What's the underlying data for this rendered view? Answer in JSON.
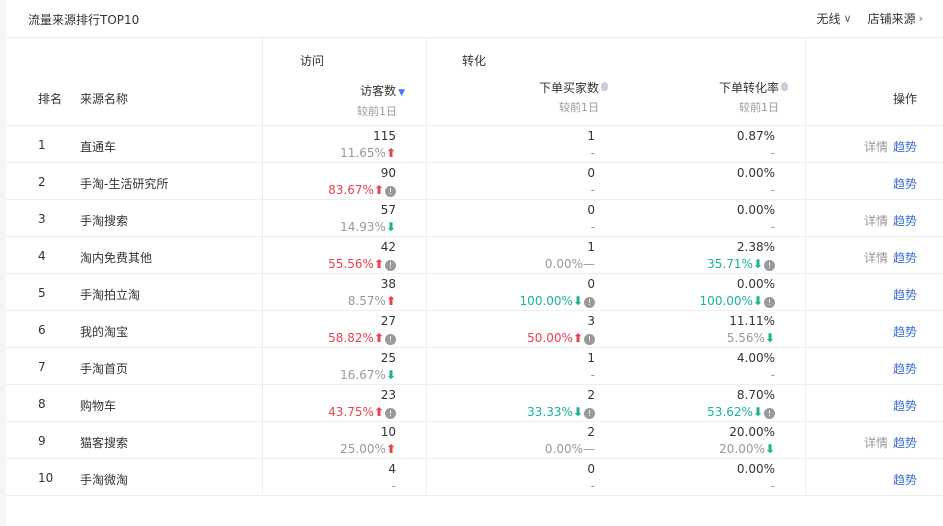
{
  "header": {
    "title": "流量来源排行TOP10",
    "device_label": "无线",
    "source_label": "店铺来源"
  },
  "groups": {
    "visit": "访问",
    "convert": "转化"
  },
  "columns": {
    "rank": "排名",
    "name": "来源名称",
    "visitors": "访客数",
    "buyers": "下单买家数",
    "rate": "下单转化率",
    "compare": "较前1日",
    "action": "操作"
  },
  "actions": {
    "detail": "详情",
    "trend": "趋势"
  },
  "rows": [
    {
      "rank": "1",
      "name": "直通车",
      "visitors": "115",
      "visitors_cmp": "11.65%",
      "visitors_dir": "up",
      "visitors_color": "gray",
      "visitors_q": false,
      "buyers": "1",
      "buyers_cmp": "-",
      "buyers_dir": "",
      "buyers_color": "gray",
      "buyers_q": false,
      "rate": "0.87%",
      "rate_cmp": "-",
      "rate_dir": "",
      "rate_color": "gray",
      "rate_q": false,
      "detail": true
    },
    {
      "rank": "2",
      "name": "手淘-生活研究所",
      "visitors": "90",
      "visitors_cmp": "83.67%",
      "visitors_dir": "up",
      "visitors_color": "red",
      "visitors_q": true,
      "buyers": "0",
      "buyers_cmp": "-",
      "buyers_dir": "",
      "buyers_color": "gray",
      "buyers_q": false,
      "rate": "0.00%",
      "rate_cmp": "-",
      "rate_dir": "",
      "rate_color": "gray",
      "rate_q": false,
      "detail": false
    },
    {
      "rank": "3",
      "name": "手淘搜索",
      "visitors": "57",
      "visitors_cmp": "14.93%",
      "visitors_dir": "down",
      "visitors_color": "gray",
      "visitors_q": false,
      "buyers": "0",
      "buyers_cmp": "-",
      "buyers_dir": "",
      "buyers_color": "gray",
      "buyers_q": false,
      "rate": "0.00%",
      "rate_cmp": "-",
      "rate_dir": "",
      "rate_color": "gray",
      "rate_q": false,
      "detail": true
    },
    {
      "rank": "4",
      "name": "淘内免费其他",
      "visitors": "42",
      "visitors_cmp": "55.56%",
      "visitors_dir": "up",
      "visitors_color": "red",
      "visitors_q": true,
      "buyers": "1",
      "buyers_cmp": "0.00%",
      "buyers_dir": "flat",
      "buyers_color": "gray",
      "buyers_q": false,
      "rate": "2.38%",
      "rate_cmp": "35.71%",
      "rate_dir": "down",
      "rate_color": "green",
      "rate_q": true,
      "detail": true
    },
    {
      "rank": "5",
      "name": "手淘拍立淘",
      "visitors": "38",
      "visitors_cmp": "8.57%",
      "visitors_dir": "up",
      "visitors_color": "gray",
      "visitors_q": false,
      "buyers": "0",
      "buyers_cmp": "100.00%",
      "buyers_dir": "down",
      "buyers_color": "green",
      "buyers_q": true,
      "rate": "0.00%",
      "rate_cmp": "100.00%",
      "rate_dir": "down",
      "rate_color": "green",
      "rate_q": true,
      "detail": false
    },
    {
      "rank": "6",
      "name": "我的淘宝",
      "visitors": "27",
      "visitors_cmp": "58.82%",
      "visitors_dir": "up",
      "visitors_color": "red",
      "visitors_q": true,
      "buyers": "3",
      "buyers_cmp": "50.00%",
      "buyers_dir": "up",
      "buyers_color": "red",
      "buyers_q": true,
      "rate": "11.11%",
      "rate_cmp": "5.56%",
      "rate_dir": "down",
      "rate_color": "gray",
      "rate_q": false,
      "detail": false
    },
    {
      "rank": "7",
      "name": "手淘首页",
      "visitors": "25",
      "visitors_cmp": "16.67%",
      "visitors_dir": "down",
      "visitors_color": "gray",
      "visitors_q": false,
      "buyers": "1",
      "buyers_cmp": "-",
      "buyers_dir": "",
      "buyers_color": "gray",
      "buyers_q": false,
      "rate": "4.00%",
      "rate_cmp": "-",
      "rate_dir": "",
      "rate_color": "gray",
      "rate_q": false,
      "detail": false
    },
    {
      "rank": "8",
      "name": "购物车",
      "visitors": "23",
      "visitors_cmp": "43.75%",
      "visitors_dir": "up",
      "visitors_color": "red",
      "visitors_q": true,
      "buyers": "2",
      "buyers_cmp": "33.33%",
      "buyers_dir": "down",
      "buyers_color": "green",
      "buyers_q": true,
      "rate": "8.70%",
      "rate_cmp": "53.62%",
      "rate_dir": "down",
      "rate_color": "green",
      "rate_q": true,
      "detail": false
    },
    {
      "rank": "9",
      "name": "猫客搜索",
      "visitors": "10",
      "visitors_cmp": "25.00%",
      "visitors_dir": "up",
      "visitors_color": "gray",
      "visitors_q": false,
      "buyers": "2",
      "buyers_cmp": "0.00%",
      "buyers_dir": "flat",
      "buyers_color": "gray",
      "buyers_q": false,
      "rate": "20.00%",
      "rate_cmp": "20.00%",
      "rate_dir": "down",
      "rate_color": "gray",
      "rate_q": false,
      "detail": true
    },
    {
      "rank": "10",
      "name": "手淘微淘",
      "visitors": "4",
      "visitors_cmp": "-",
      "visitors_dir": "",
      "visitors_color": "gray",
      "visitors_q": false,
      "buyers": "0",
      "buyers_cmp": "-",
      "buyers_dir": "",
      "buyers_color": "gray",
      "buyers_q": false,
      "rate": "0.00%",
      "rate_cmp": "-",
      "rate_dir": "",
      "rate_color": "gray",
      "rate_q": false,
      "detail": false
    }
  ]
}
